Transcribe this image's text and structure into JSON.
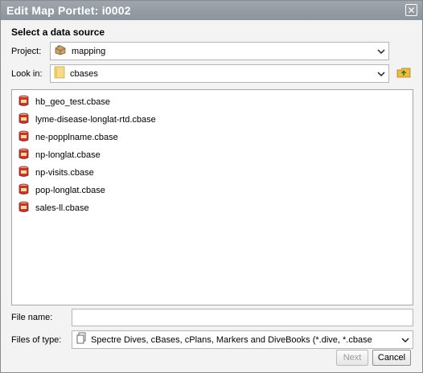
{
  "window": {
    "title": "Edit Map Portlet: i0002",
    "close_glyph": "✕"
  },
  "section_title": "Select a data source",
  "project": {
    "label": "Project:",
    "value": "mapping"
  },
  "look_in": {
    "label": "Look in:",
    "value": "cbases"
  },
  "files": [
    {
      "name": "hb_geo_test.cbase",
      "icon": "cbase-icon"
    },
    {
      "name": "lyme-disease-longlat-rtd.cbase",
      "icon": "cbase-icon"
    },
    {
      "name": "ne-popplname.cbase",
      "icon": "cbase-icon"
    },
    {
      "name": "np-longlat.cbase",
      "icon": "cbase-icon"
    },
    {
      "name": "np-visits.cbase",
      "icon": "cbase-icon"
    },
    {
      "name": "pop-longlat.cbase",
      "icon": "cbase-icon"
    },
    {
      "name": "sales-ll.cbase",
      "icon": "cbase-icon"
    }
  ],
  "file_name": {
    "label": "File name:",
    "value": ""
  },
  "files_of_type": {
    "label": "Files of type:",
    "value": "Spectre Dives, cBases, cPlans, Markers and DiveBooks (*.dive, *.cbase"
  },
  "buttons": {
    "next": "Next",
    "cancel": "Cancel"
  },
  "colors": {
    "titlebar": "#9aa1a8",
    "folder": "#f3d27a",
    "cbase_red": "#b8322a",
    "up_arrow": "#d8a531"
  }
}
